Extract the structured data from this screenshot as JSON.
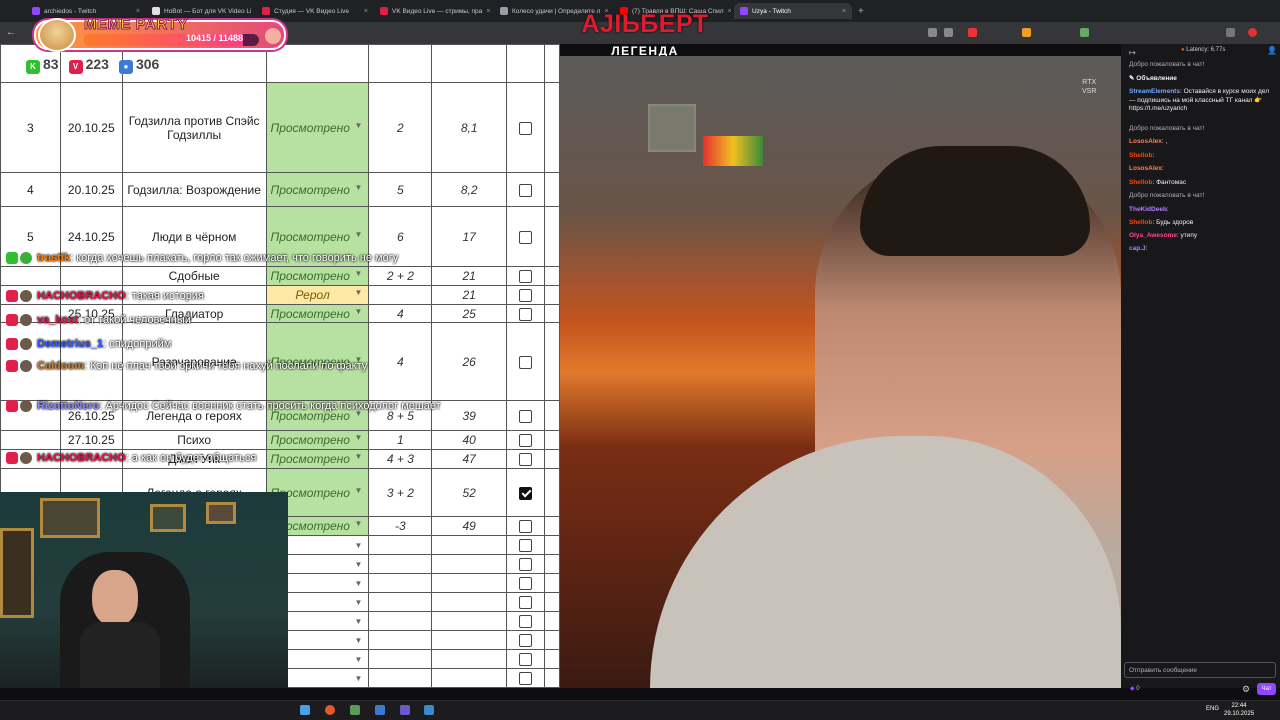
{
  "browser": {
    "tabs": [
      {
        "label": "archiedos - Twitch",
        "color": "#9147ff"
      },
      {
        "label": "HoBot — Бот для VK Video Li",
        "color": "#e0e0e0"
      },
      {
        "label": "Студия — VK Видео Live",
        "color": "#e21f4a"
      },
      {
        "label": "VK Видео Live — стримы, пра",
        "color": "#e21f4a"
      },
      {
        "label": "Колесо удачи | Определите л",
        "color": "#9aa0a6"
      },
      {
        "label": "(7) Травля в ВПШ: Саша Спил",
        "color": "#ff0000"
      },
      {
        "label": "Uzya - Twitch",
        "color": "#9147ff"
      }
    ]
  },
  "overlay": {
    "meme_title": "MEME PARTY",
    "meme_count": "10415 / 11488",
    "meme_progress": 0.9066,
    "nickname": "AJIЬБЕРТ",
    "legend": "ЛЕГЕНДА",
    "counters": {
      "kick": "83",
      "vk": "223",
      "twitch": "306"
    },
    "rtx": "RTX",
    "vsr": "VSR"
  },
  "sheet": {
    "rows": [
      {
        "n": "3",
        "date": "20.10.25",
        "title": "Годзилла против Спэйс Годзиллы",
        "status": "Просмотрено",
        "votes": "2",
        "rating": "8,1",
        "checked": false
      },
      {
        "n": "4",
        "date": "20.10.25",
        "title": "Годзилла: Возрождение",
        "status": "Просмотрено",
        "votes": "5",
        "rating": "8,2",
        "checked": false
      },
      {
        "n": "5",
        "date": "24.10.25",
        "title": "Люди в чёрном",
        "status": "Просмотрено",
        "votes": "6",
        "rating": "17",
        "checked": false
      },
      {
        "n": "",
        "date": "",
        "title": "Сдобные",
        "status": "Просмотрено",
        "votes": "2 + 2",
        "rating": "21",
        "checked": false
      },
      {
        "n": "",
        "date": "",
        "title": "",
        "status": "Рерол",
        "votes": "",
        "rating": "21",
        "checked": false
      },
      {
        "n": "",
        "date": "25.10.25",
        "title": "Гладиатор",
        "status": "Просмотрено",
        "votes": "4",
        "rating": "25",
        "checked": false
      },
      {
        "n": "",
        "date": "",
        "title": "Разочарование",
        "status": "Просмотрено",
        "votes": "4",
        "rating": "26",
        "checked": false
      },
      {
        "n": "",
        "date": "26.10.25",
        "title": "Легенда о героях",
        "status": "Просмотрено",
        "votes": "8 + 5",
        "rating": "39",
        "checked": false
      },
      {
        "n": "",
        "date": "27.10.25",
        "title": "Психо",
        "status": "Просмотрено",
        "votes": "1",
        "rating": "40",
        "checked": false
      },
      {
        "n": "",
        "date": "",
        "title": "Джон Уик",
        "status": "Просмотрено",
        "votes": "4 + 3",
        "rating": "47",
        "checked": false
      },
      {
        "n": "",
        "date": "",
        "title": "Легенда о героях",
        "status": "Просмотрено",
        "votes": "3 + 2",
        "rating": "52",
        "checked": true
      },
      {
        "n": "",
        "date": "",
        "title": "",
        "status": "Просмотрено",
        "votes": "-3",
        "rating": "49",
        "checked": false
      }
    ]
  },
  "overlay_chat": [
    {
      "user": "trastik",
      "text": "когда хочешь плакать, горло так сжимает, что говорить не могу",
      "color": "#ff7b00"
    },
    {
      "user": "HACHOBRACHO",
      "text": "такая история",
      "color": "#e0174a"
    },
    {
      "user": "va_kost",
      "text": "от такой человечный",
      "color": "#e0174a"
    },
    {
      "user": "Demetrius_1",
      "text": "спидоприйм",
      "color": "#3a5bff"
    },
    {
      "user": "Caldoom",
      "text": "Кэп не плач твой эркичи тебя нахуй послали по факту",
      "color": "#c97c32"
    },
    {
      "user": "RizottoNero",
      "text": "Арчидос Сейчас военник стать просить когда психодолог мешает",
      "color": "#8a8aff"
    },
    {
      "user": "HACHOBRACHO",
      "text": "а как он будет общаться",
      "color": "#e0174a"
    }
  ],
  "chat": {
    "latency": "Latency: 6.77s",
    "welcome": "Добро пожаловать в чат!",
    "announcement": "Объявление",
    "announcement_user": "StreamElements",
    "announcement_text": ": Оставайся в курсе моих дел — подпишись на мой классный ТГ канал 👉 https://t.me/uzyarich",
    "messages": [
      {
        "user": "LososAlex",
        "text": ": ,",
        "color": "#ff7f50"
      },
      {
        "user": "Shellob",
        "text": ":",
        "color": "#ff4500"
      },
      {
        "user": "LososAlex",
        "text": ":",
        "color": "#ff7f50"
      },
      {
        "user": "Shellob",
        "text": ": Фантомас",
        "color": "#ff4500"
      }
    ],
    "welcome2": "Добро пожаловать в чат!",
    "messages2": [
      {
        "user": "TheKidDeeb",
        "text": ":",
        "color": "#b37cff"
      },
      {
        "user": "Shellob",
        "text": ": Будь здоров",
        "color": "#ff4500"
      },
      {
        "user": "Olya_Awesome",
        "text": ": утипу",
        "color": "#ff4a8a"
      },
      {
        "user": "cap.J",
        "text": ":",
        "color": "#8f8fff"
      }
    ],
    "input_placeholder": "Отправить сообщение",
    "points": "0",
    "send_label": "Чат"
  },
  "taskbar": {
    "lang": "ENG",
    "time": "22:44",
    "date": "29.10.2025"
  }
}
